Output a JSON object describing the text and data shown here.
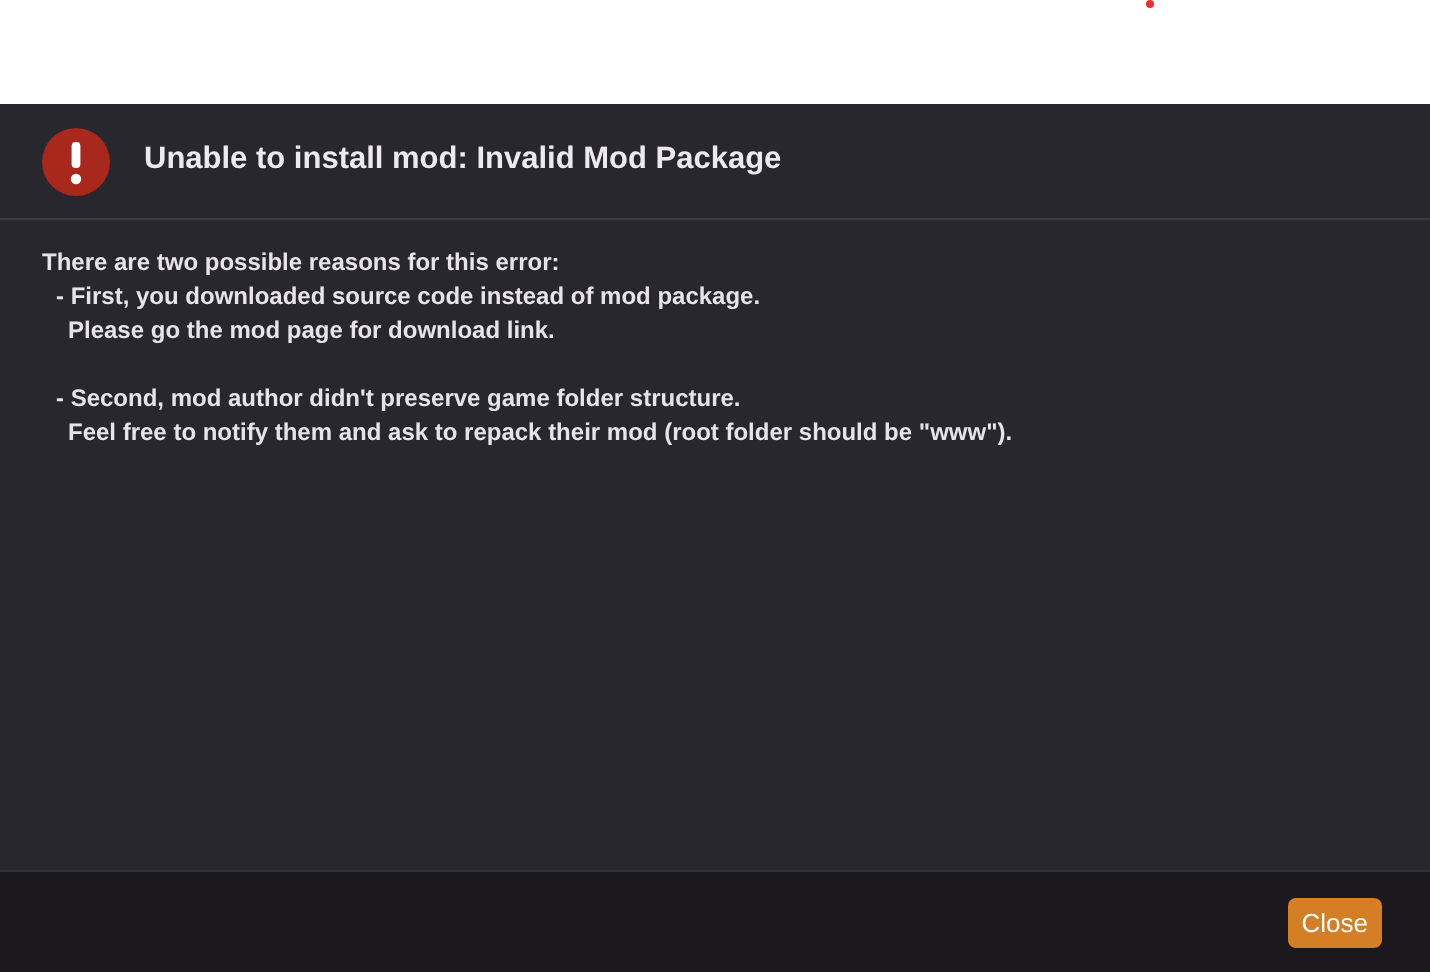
{
  "dialog": {
    "title": "Unable to install mod: Invalid Mod Package",
    "intro": "There are two possible reasons for this error:",
    "reasons": [
      {
        "lines": [
          "- First, you downloaded source code instead of mod package.",
          "Please go the mod page for download link."
        ]
      },
      {
        "lines": [
          "- Second, mod author didn't preserve game folder structure.",
          "Feel free to notify them and ask to repack their mod (root folder should be \"www\")."
        ]
      }
    ],
    "buttons": [
      {
        "label": "Close",
        "kind": "primary"
      }
    ]
  }
}
